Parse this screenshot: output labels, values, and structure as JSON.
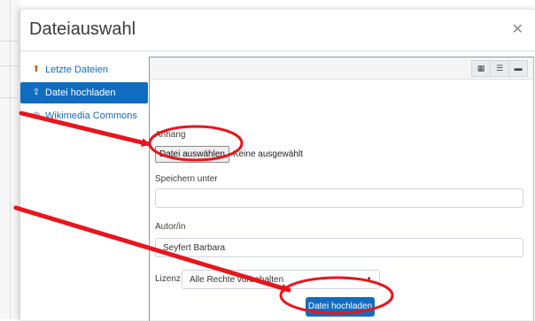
{
  "dialog": {
    "title": "Dateiauswahl",
    "close_icon": "close-icon"
  },
  "nav": {
    "items": [
      {
        "label": "Letzte Dateien",
        "icon": "recent-files-icon",
        "active": false
      },
      {
        "label": "Datei hochladen",
        "icon": "upload-icon",
        "active": true
      },
      {
        "label": "Wikimedia Commons",
        "icon": "wikimedia-icon",
        "active": false
      }
    ]
  },
  "toolbar": {
    "view_icons": [
      "grid-view-icon",
      "list-view-icon",
      "folder-view-icon"
    ]
  },
  "form": {
    "attachment_label": "Anhang",
    "choose_file_label": "Datei auswählen",
    "file_status": "Keine ausgewählt",
    "save_as_label": "Speichern unter",
    "save_as_value": "",
    "author_label": "Autor/in",
    "author_value": "Seyfert Barbara",
    "license_label": "Lizenz",
    "license_value": "Alle Rechte vorbehalten",
    "upload_label": "Datei hochladen"
  },
  "colors": {
    "accent": "#0f6cbf",
    "annotation": "#e8151c"
  }
}
